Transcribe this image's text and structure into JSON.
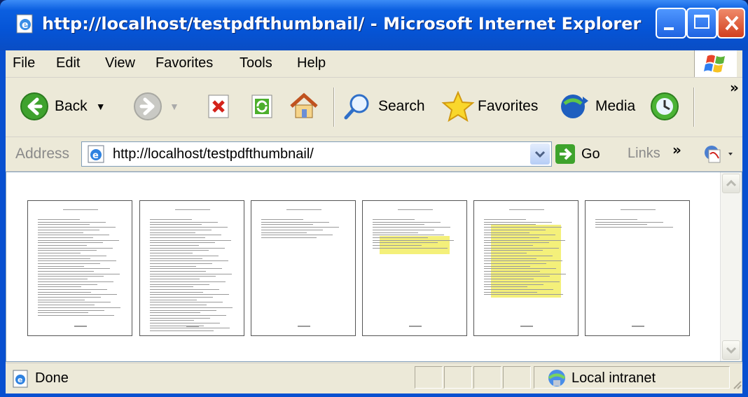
{
  "window": {
    "title": "http://localhost/testpdfthumbnail/ - Microsoft Internet Explorer"
  },
  "menu": [
    {
      "label": "File"
    },
    {
      "label": "Edit"
    },
    {
      "label": "View"
    },
    {
      "label": "Favorites"
    },
    {
      "label": "Tools"
    },
    {
      "label": "Help"
    }
  ],
  "toolbar": {
    "back_label": "Back",
    "search_label": "Search",
    "favorites_label": "Favorites",
    "media_label": "Media",
    "more_glyph": "»"
  },
  "address": {
    "label": "Address",
    "url": "http://localhost/testpdfthumbnail/",
    "go_label": "Go",
    "links_label": "Links",
    "links_more": "»"
  },
  "content": {
    "thumbnails": [
      {
        "page": 1,
        "highlight": false
      },
      {
        "page": 2,
        "highlight": false
      },
      {
        "page": 3,
        "highlight": false
      },
      {
        "page": 4,
        "highlight": true
      },
      {
        "page": 5,
        "highlight": true
      },
      {
        "page": 6,
        "highlight": false
      }
    ]
  },
  "status": {
    "text": "Done",
    "zone": "Local intranet"
  },
  "colors": {
    "title_bar": "#0554d6",
    "chrome": "#ece9d8",
    "highlight": "#f4f07a"
  }
}
